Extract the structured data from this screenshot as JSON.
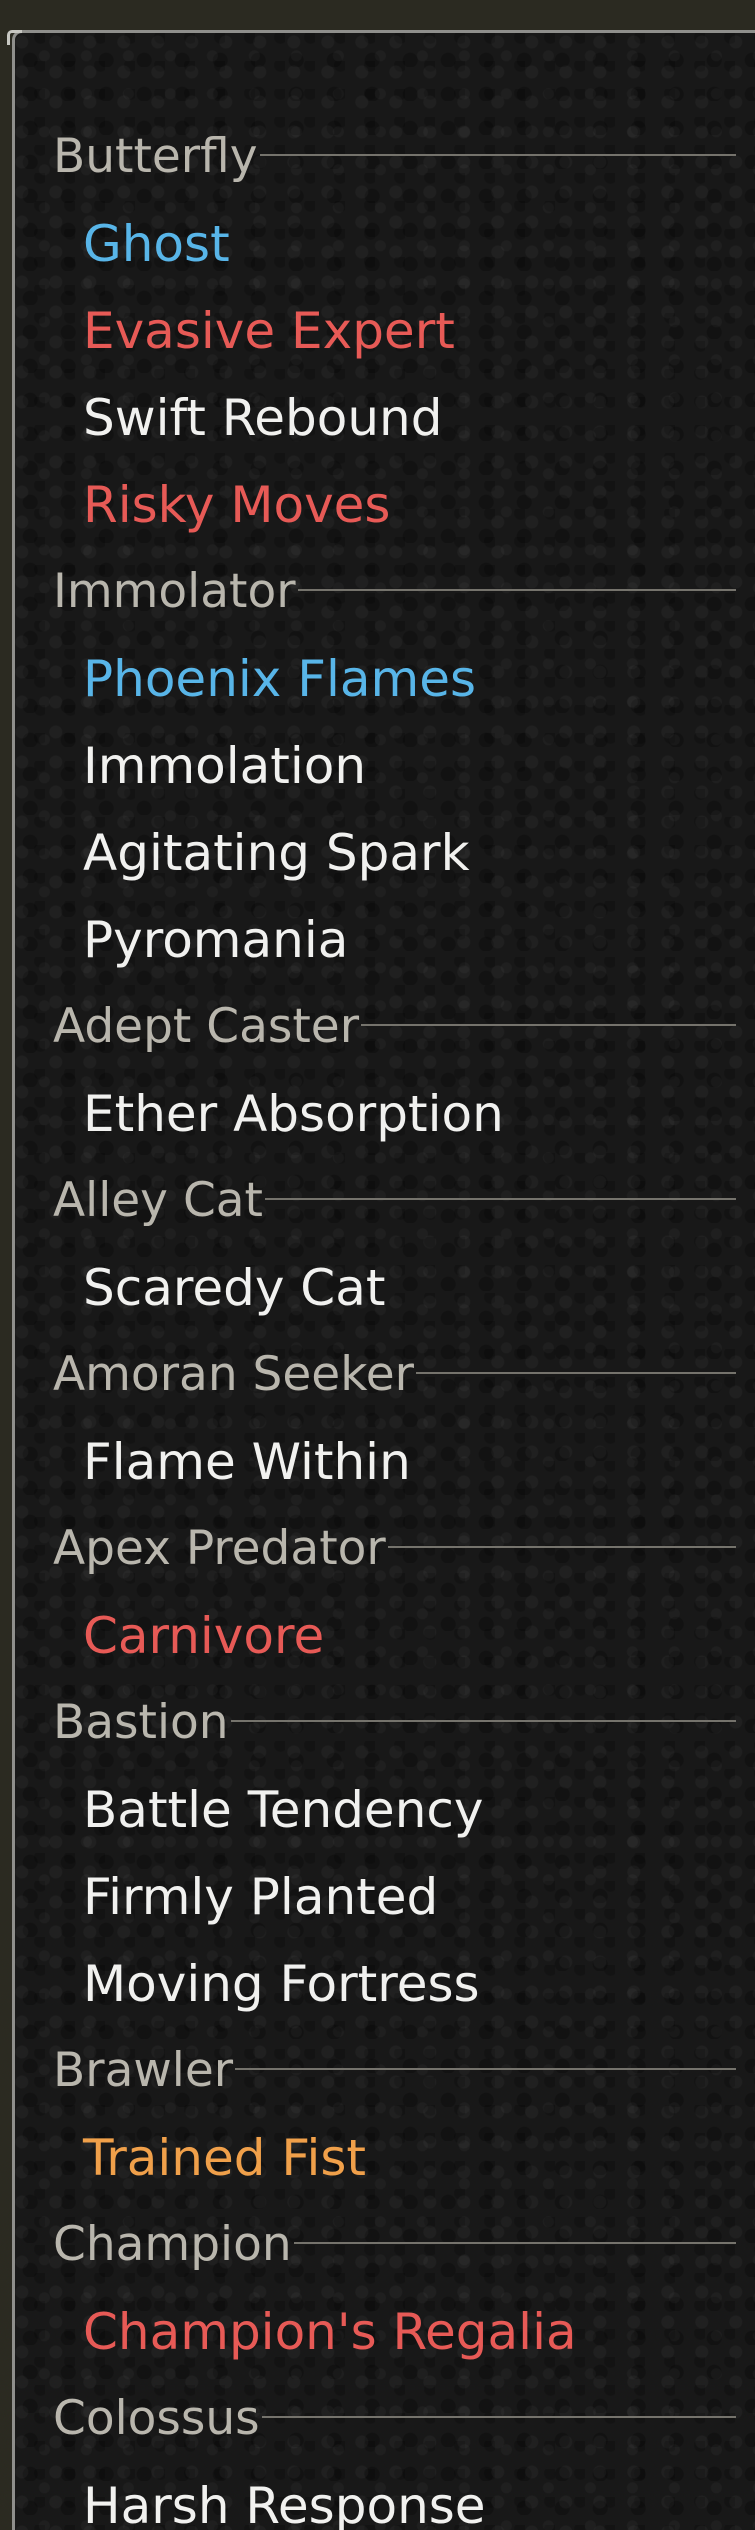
{
  "colors": {
    "header": "#b9b6ad",
    "white": "#f1f1ef",
    "blue": "#58b5e8",
    "red": "#e75a56",
    "orange": "#f0a04a"
  },
  "groups": [
    {
      "label": "Butterfly",
      "items": [
        {
          "label": "Ghost",
          "color": "#58b5e8"
        },
        {
          "label": "Evasive Expert",
          "color": "#e75a56"
        },
        {
          "label": "Swift Rebound",
          "color": "#f1f1ef"
        },
        {
          "label": "Risky Moves",
          "color": "#e75a56"
        }
      ]
    },
    {
      "label": "Immolator",
      "items": [
        {
          "label": "Phoenix Flames",
          "color": "#58b5e8"
        },
        {
          "label": "Immolation",
          "color": "#f1f1ef"
        },
        {
          "label": "Agitating Spark",
          "color": "#f1f1ef"
        },
        {
          "label": "Pyromania",
          "color": "#f1f1ef"
        }
      ]
    },
    {
      "label": "Adept Caster",
      "items": [
        {
          "label": "Ether Absorption",
          "color": "#f1f1ef"
        }
      ]
    },
    {
      "label": "Alley Cat",
      "items": [
        {
          "label": "Scaredy Cat",
          "color": "#f1f1ef"
        }
      ]
    },
    {
      "label": "Amoran Seeker",
      "items": [
        {
          "label": "Flame Within",
          "color": "#f1f1ef"
        }
      ]
    },
    {
      "label": "Apex Predator",
      "items": [
        {
          "label": "Carnivore",
          "color": "#e75a56"
        }
      ]
    },
    {
      "label": "Bastion",
      "items": [
        {
          "label": "Battle Tendency",
          "color": "#f1f1ef"
        },
        {
          "label": "Firmly Planted",
          "color": "#f1f1ef"
        },
        {
          "label": "Moving Fortress",
          "color": "#f1f1ef"
        }
      ]
    },
    {
      "label": "Brawler",
      "items": [
        {
          "label": "Trained Fist",
          "color": "#f0a04a"
        }
      ]
    },
    {
      "label": "Champion",
      "items": [
        {
          "label": "Champion's Regalia",
          "color": "#e75a56"
        }
      ]
    },
    {
      "label": "Colossus",
      "items": [
        {
          "label": "Harsh Response",
          "color": "#f1f1ef"
        }
      ]
    }
  ]
}
